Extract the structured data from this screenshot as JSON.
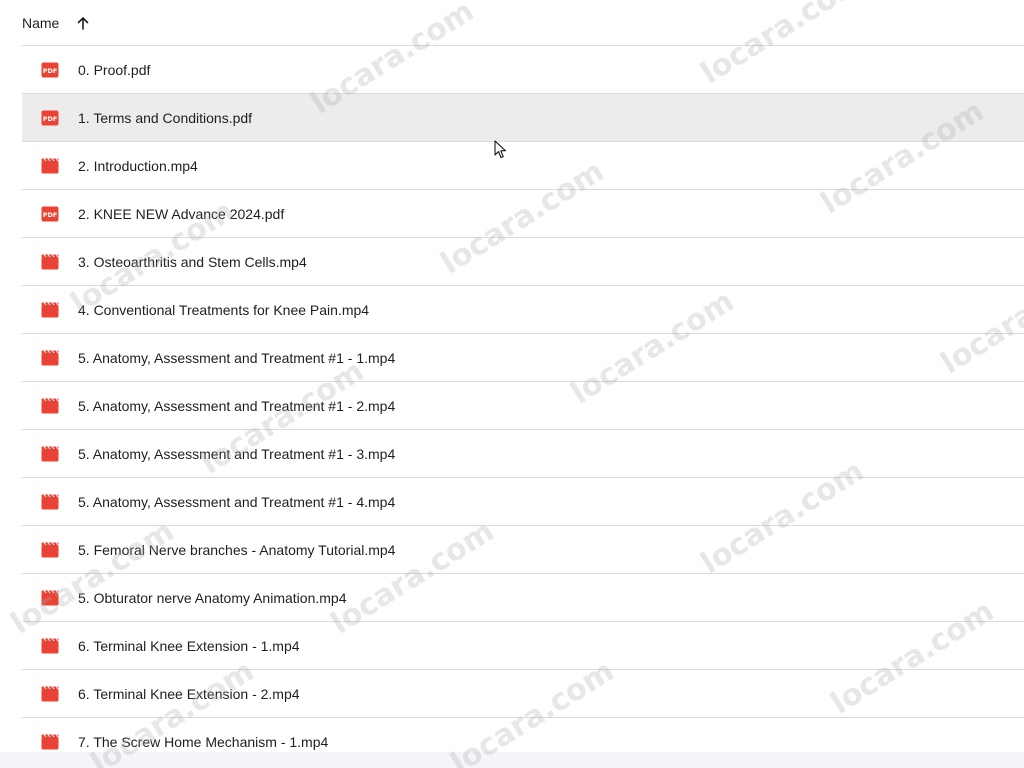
{
  "header": {
    "name_label": "Name",
    "sort_icon": "arrow-up-icon"
  },
  "files": [
    {
      "name": "0. Proof.pdf",
      "type": "pdf",
      "icon": "pdf-icon"
    },
    {
      "name": "1. Terms and Conditions.pdf",
      "type": "pdf",
      "icon": "pdf-icon",
      "hovered": true
    },
    {
      "name": "2. Introduction.mp4",
      "type": "video",
      "icon": "video-icon"
    },
    {
      "name": "2. KNEE NEW Advance 2024.pdf",
      "type": "pdf",
      "icon": "pdf-icon"
    },
    {
      "name": "3. Osteoarthritis and Stem Cells.mp4",
      "type": "video",
      "icon": "video-icon"
    },
    {
      "name": "4. Conventional Treatments for Knee Pain.mp4",
      "type": "video",
      "icon": "video-icon"
    },
    {
      "name": "5. Anatomy, Assessment and Treatment #1 - 1.mp4",
      "type": "video",
      "icon": "video-icon"
    },
    {
      "name": "5. Anatomy, Assessment and Treatment #1 - 2.mp4",
      "type": "video",
      "icon": "video-icon"
    },
    {
      "name": "5. Anatomy, Assessment and Treatment #1 - 3.mp4",
      "type": "video",
      "icon": "video-icon"
    },
    {
      "name": "5. Anatomy, Assessment and Treatment #1 - 4.mp4",
      "type": "video",
      "icon": "video-icon"
    },
    {
      "name": "5. Femoral Nerve branches - Anatomy Tutorial.mp4",
      "type": "video",
      "icon": "video-icon"
    },
    {
      "name": "5. Obturator nerve Anatomy Animation.mp4",
      "type": "video",
      "icon": "video-icon"
    },
    {
      "name": "6. Terminal Knee Extension - 1.mp4",
      "type": "video",
      "icon": "video-icon"
    },
    {
      "name": "6. Terminal Knee Extension - 2.mp4",
      "type": "video",
      "icon": "video-icon"
    },
    {
      "name": "7. The Screw Home Mechanism - 1.mp4",
      "type": "video",
      "icon": "video-icon"
    }
  ],
  "watermark": {
    "text": "locara.com"
  },
  "colors": {
    "file_icon_red": "#ea4335",
    "hover_row": "#ececec",
    "divider": "#dadce0",
    "text": "#1f1f1f"
  }
}
